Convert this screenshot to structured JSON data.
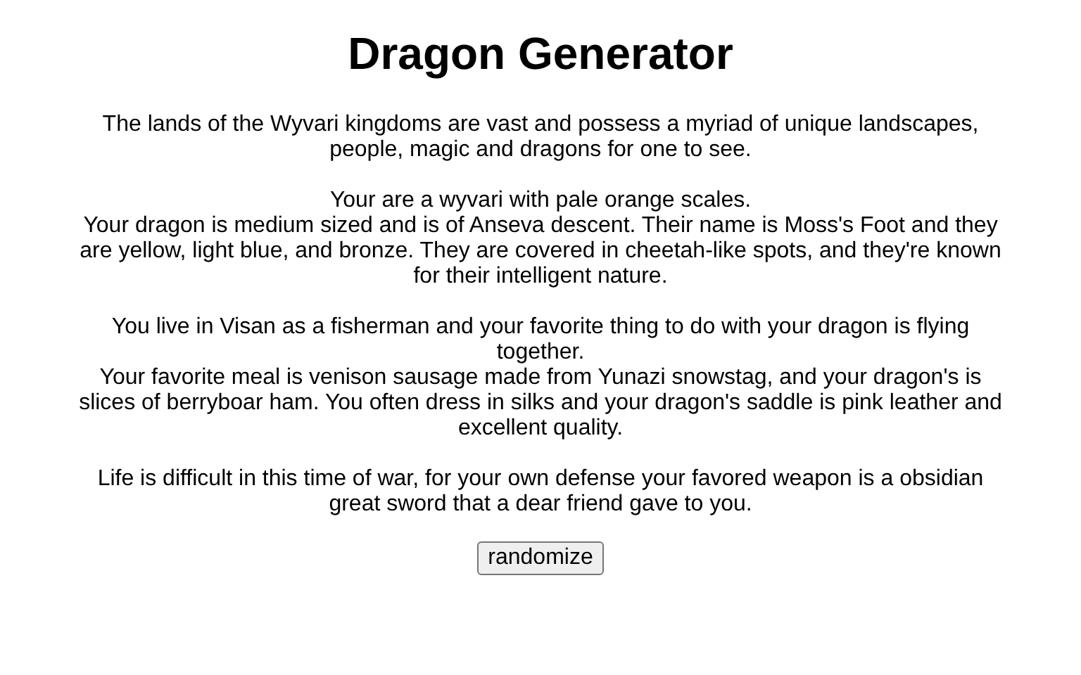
{
  "title": "Dragon Generator",
  "paragraphs": [
    {
      "lines": [
        "The lands of the Wyvari kingdoms are vast and possess a myriad of unique landscapes, people, magic and dragons for one to see."
      ]
    },
    {
      "lines": [
        "Your are a wyvari with pale orange scales.",
        "Your dragon is medium sized and is of Anseva descent. Their name is Moss's Foot and they are yellow, light blue, and bronze. They are covered in cheetah-like spots, and they're known for their intelligent nature."
      ]
    },
    {
      "lines": [
        "You live in Visan as a fisherman and your favorite thing to do with your dragon is flying together.",
        "Your favorite meal is venison sausage made from Yunazi snowstag, and your dragon's is slices of berryboar ham. You often dress in silks and your dragon's saddle is pink leather and excellent quality."
      ]
    },
    {
      "lines": [
        "Life is difficult in this time of war, for your own defense your favored weapon is a obsidian great sword that a dear friend gave to you."
      ]
    }
  ],
  "button": "randomize"
}
